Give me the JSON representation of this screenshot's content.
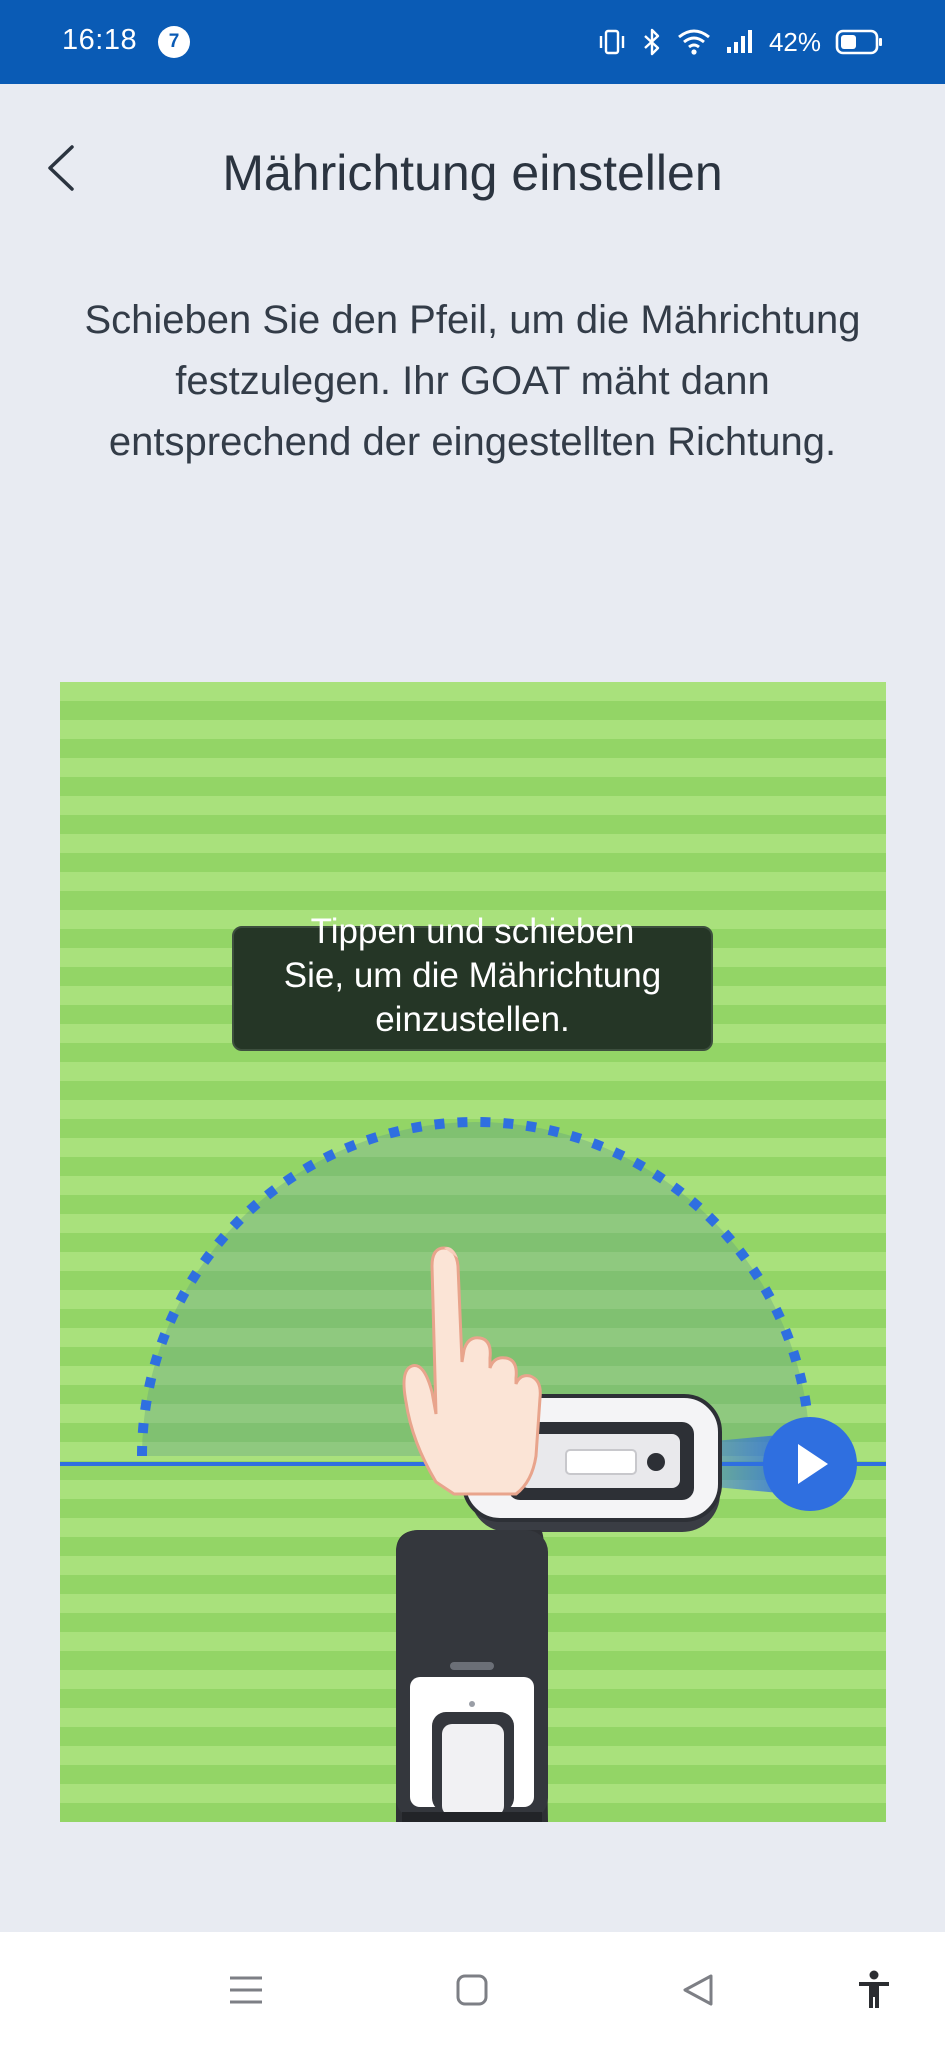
{
  "status_bar": {
    "time": "16:18",
    "notification_count": "7",
    "battery_percent": "42%",
    "icons": [
      "vibrate-icon",
      "bluetooth-icon",
      "wifi-icon",
      "signal-icon",
      "battery-icon"
    ]
  },
  "header": {
    "back_icon": "chevron-left-icon",
    "title": "Mährichtung einstellen"
  },
  "instruction": "Schieben Sie den Pfeil, um die Mährichtung festzulegen. Ihr GOAT mäht dann entsprechend der eingestellten Richtung.",
  "illustration": {
    "tooltip": "Tippen und schieben Sie, um die Mährichtung einzustellen.",
    "arrow_handle_icon": "play-arrow-icon",
    "colors": {
      "grass_light": "#a9e17c",
      "grass_dark": "#93d566",
      "accent_blue": "#2f6fe0",
      "tooltip_bg": "#253626"
    }
  },
  "nav_bar": {
    "icons": [
      "menu-icon",
      "home-square-icon",
      "back-triangle-icon",
      "accessibility-icon"
    ]
  },
  "colors": {
    "status_bar": "#0a5bb5",
    "background": "#e8ebf2",
    "text_primary": "#2b3440"
  }
}
